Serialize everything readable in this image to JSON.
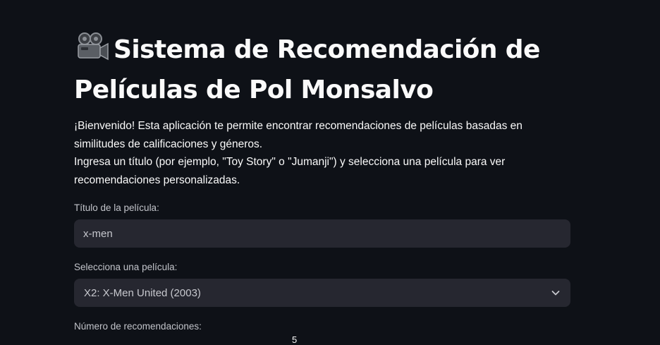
{
  "header": {
    "title_icon": "movie-camera-icon",
    "title": "Sistema de Recomendación de Películas de Pol Monsalvo"
  },
  "intro": {
    "line1": "¡Bienvenido! Esta aplicación te permite encontrar recomendaciones de películas basadas en similitudes de calificaciones y géneros.",
    "line2": "Ingresa un título (por ejemplo, \"Toy Story\" o \"Jumanji\") y selecciona una película para ver recomendaciones personalizadas."
  },
  "title_field": {
    "label": "Título de la película:",
    "value": "x-men"
  },
  "movie_select": {
    "label": "Selecciona una película:",
    "selected": "X2: X-Men United (2003)",
    "icon": "chevron-down-icon"
  },
  "recommendations": {
    "label": "Número de recomendaciones:",
    "value": "5"
  },
  "colors": {
    "background": "#0e1117",
    "input_background": "#262730",
    "text": "#fafafa",
    "muted_text": "#c2c4ca"
  }
}
